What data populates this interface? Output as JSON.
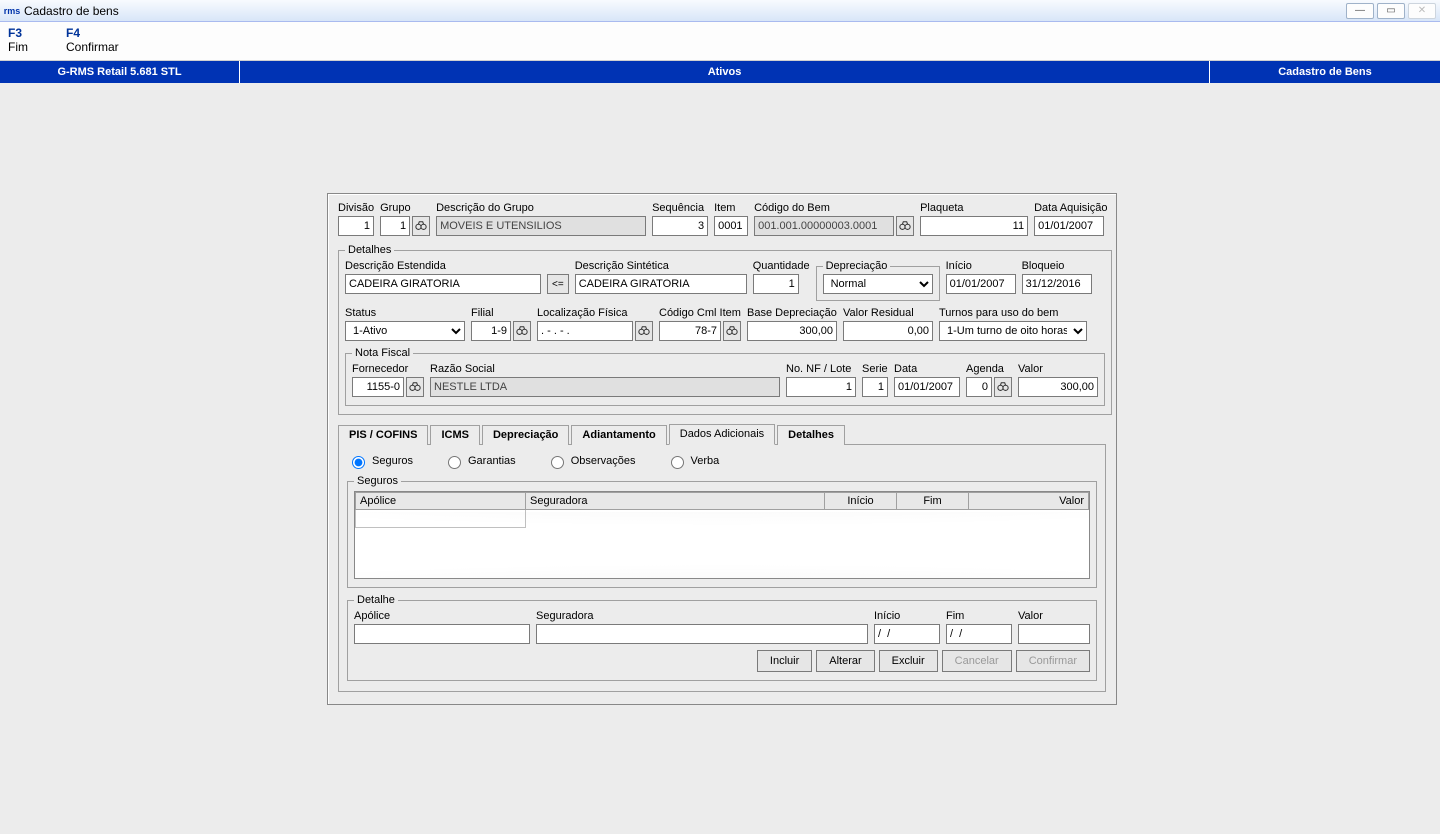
{
  "window": {
    "title": "Cadastro de bens",
    "app_icon": "rms"
  },
  "menu": {
    "items": [
      {
        "key": "F3",
        "label": "Fim"
      },
      {
        "key": "F4",
        "label": "Confirmar"
      }
    ]
  },
  "bluebar": {
    "left": "G-RMS Retail 5.681 STL",
    "mid": "Ativos",
    "right": "Cadastro de Bens"
  },
  "top": {
    "divisao_label": "Divisão",
    "divisao": "1",
    "grupo_label": "Grupo",
    "grupo": "1",
    "desc_grupo_label": "Descrição do Grupo",
    "desc_grupo": "MOVEIS E UTENSILIOS",
    "sequencia_label": "Sequência",
    "sequencia": "3",
    "item_label": "Item",
    "item": "0001",
    "codigo_bem_label": "Código do Bem",
    "codigo_bem": "001.001.00000003.0001",
    "plaqueta_label": "Plaqueta",
    "plaqueta": "11",
    "data_aq_label": "Data Aquisição",
    "data_aq": "01/01/2007"
  },
  "detalhes": {
    "legend": "Detalhes",
    "desc_est_label": "Descrição Estendida",
    "desc_est": "CADEIRA GIRATORIA",
    "copy_btn": "<=",
    "desc_sint_label": "Descrição Sintética",
    "desc_sint": "CADEIRA GIRATORIA",
    "quant_label": "Quantidade",
    "quant": "1",
    "dep_legend": "Depreciação",
    "dep_tipo": "Normal",
    "inicio_label": "Início",
    "inicio": "01/01/2007",
    "bloqueio_label": "Bloqueio",
    "bloqueio": "31/12/2016",
    "status_label": "Status",
    "status": "1-Ativo",
    "filial_label": "Filial",
    "filial": "1-9",
    "loc_fisica_label": "Localização Física",
    "loc_fisica": ". - . - .",
    "cod_cml_label": "Código Cml Item",
    "cod_cml": "78-7",
    "base_dep_label": "Base Depreciação",
    "base_dep": "300,00",
    "valor_res_label": "Valor Residual",
    "valor_res": "0,00",
    "turnos_label": "Turnos para uso do bem",
    "turnos": "1-Um turno de oito horas"
  },
  "nota_fiscal": {
    "legend": "Nota Fiscal",
    "fornecedor_label": "Fornecedor",
    "fornecedor": "1155-0",
    "razao_label": "Razão Social",
    "razao": "NESTLE LTDA",
    "nf_label": "No. NF / Lote",
    "nf": "1",
    "serie_label": "Serie",
    "serie": "1",
    "data_label": "Data",
    "data": "01/01/2007",
    "agenda_label": "Agenda",
    "agenda": "0",
    "valor_label": "Valor",
    "valor": "300,00"
  },
  "tabs": {
    "pis": "PIS / COFINS",
    "icms": "ICMS",
    "dep": "Depreciação",
    "adi": "Adiantamento",
    "dados": "Dados Adicionais",
    "det": "Detalhes"
  },
  "dados_tab": {
    "radios": {
      "seguros": "Seguros",
      "garantias": "Garantias",
      "obs": "Observações",
      "verba": "Verba"
    },
    "seguros_legend": "Seguros",
    "cols": {
      "apolice": "Apólice",
      "seguradora": "Seguradora",
      "inicio": "Início",
      "fim": "Fim",
      "valor": "Valor"
    },
    "detalhe_legend": "Detalhe",
    "d_apolice_label": "Apólice",
    "d_seguradora_label": "Seguradora",
    "d_inicio_label": "Início",
    "d_inicio": "/  /",
    "d_fim_label": "Fim",
    "d_fim": "/  /",
    "d_valor_label": "Valor",
    "buttons": {
      "incluir": "Incluir",
      "alterar": "Alterar",
      "excluir": "Excluir",
      "cancelar": "Cancelar",
      "confirmar": "Confirmar"
    }
  }
}
